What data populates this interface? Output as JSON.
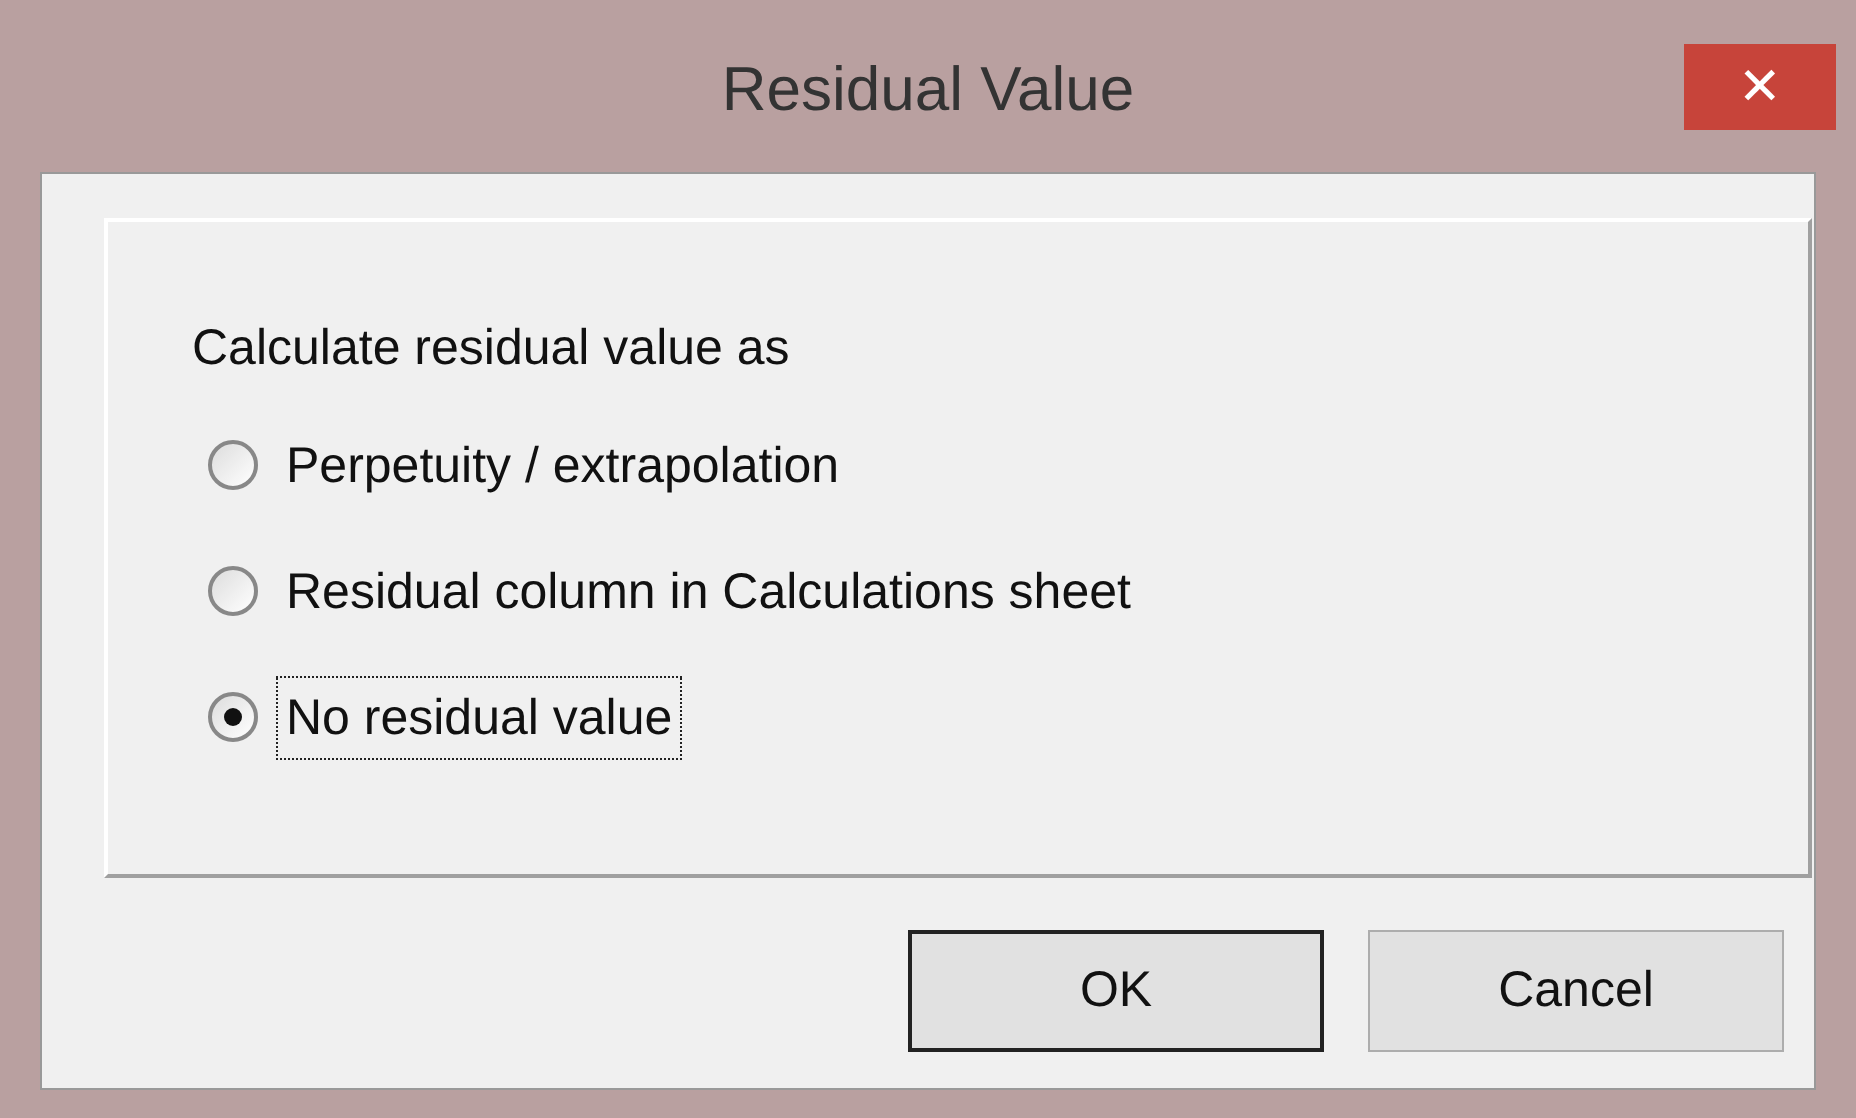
{
  "window": {
    "title": "Residual Value",
    "close": "✕"
  },
  "group": {
    "label": "Calculate residual value as",
    "options": [
      {
        "label": "Perpetuity / extrapolation",
        "selected": false,
        "focused": false
      },
      {
        "label": "Residual column in Calculations sheet",
        "selected": false,
        "focused": false
      },
      {
        "label": "No residual value",
        "selected": true,
        "focused": true
      }
    ]
  },
  "buttons": [
    {
      "label": "OK",
      "default": true
    },
    {
      "label": "Cancel",
      "default": false
    }
  ]
}
